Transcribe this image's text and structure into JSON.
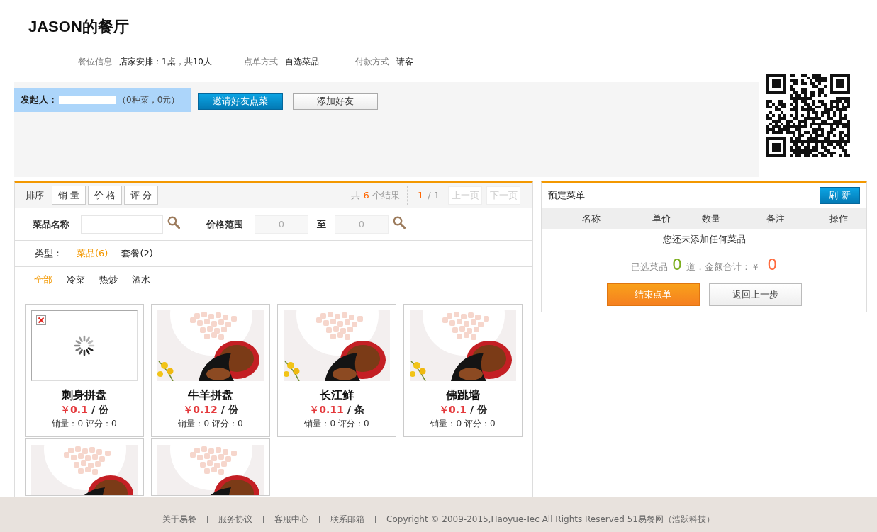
{
  "header": {
    "title": "JASON的餐厅"
  },
  "info": [
    {
      "label": "餐位信息",
      "value": "店家安排：1桌，共10人"
    },
    {
      "label": "点单方式",
      "value": "自选菜品"
    },
    {
      "label": "付款方式",
      "value": "请客"
    }
  ],
  "initiator": {
    "label": "发起人：",
    "redacted": true,
    "summary": "（0种菜，0元）"
  },
  "initiator_actions": [
    {
      "label": "邀请好友点菜",
      "kind": "primary"
    },
    {
      "label": "添加好友",
      "kind": "secondary"
    }
  ],
  "sort_bar": {
    "label": "排序",
    "options": [
      "销 量",
      "价 格",
      "评 分"
    ],
    "results": {
      "before": "共",
      "count": "6",
      "after": "个结果"
    },
    "page": {
      "current": "1",
      "total": "/ 1"
    },
    "pager": [
      {
        "label": "上一页",
        "disabled": true
      },
      {
        "label": "下一页",
        "disabled": true
      }
    ]
  },
  "search": {
    "name_label": "菜品名称",
    "price_label": "价格范围",
    "price_min_placeholder": "0",
    "range_word": "至",
    "price_max_placeholder": "0"
  },
  "type_filter": {
    "label": "类型：",
    "options": [
      {
        "label": "菜品(6)",
        "selected": true
      },
      {
        "label": "套餐(2)",
        "selected": false
      }
    ]
  },
  "categories": [
    {
      "label": "全部",
      "selected": true
    },
    {
      "label": "冷菜",
      "selected": false
    },
    {
      "label": "热炒",
      "selected": false
    },
    {
      "label": "酒水",
      "selected": false
    }
  ],
  "dishes": [
    {
      "kind": "broken",
      "name": "刺身拼盘",
      "price": "￥0.1",
      "unit": "/ 份",
      "stats": "销量：0 评分：0"
    },
    {
      "kind": "photo",
      "name": "牛羊拼盘",
      "price": "￥0.12",
      "unit": "/ 份",
      "stats": "销量：0 评分：0"
    },
    {
      "kind": "photo",
      "name": "长江鲜",
      "price": "￥0.11",
      "unit": "/ 条",
      "stats": "销量：0 评分：0"
    },
    {
      "kind": "photo",
      "name": "佛跳墙",
      "price": "￥0.1",
      "unit": "/ 份",
      "stats": "销量：0 评分：0"
    },
    {
      "kind": "photo"
    },
    {
      "kind": "photo"
    }
  ],
  "order": {
    "title": "预定菜单",
    "refresh": "刷 新",
    "columns": [
      "名称",
      "单价",
      "数量",
      "备注",
      "操作"
    ],
    "empty_message": "您还未添加任何菜品",
    "summary": {
      "count_label": "已选菜品",
      "count": "0",
      "amount_label": "道，金额合计：￥",
      "amount": "0"
    },
    "buttons": [
      {
        "label": "结束点单",
        "kind": "primary"
      },
      {
        "label": "返回上一步",
        "kind": "secondary"
      }
    ]
  },
  "footer": {
    "links": [
      "关于易餐",
      "服务协议",
      "客服中心",
      "联系邮箱"
    ],
    "copyright": "Copyright © 2009-2015,Haoyue-Tec All Rights Reserved 51易餐网（浩跃科技）"
  }
}
